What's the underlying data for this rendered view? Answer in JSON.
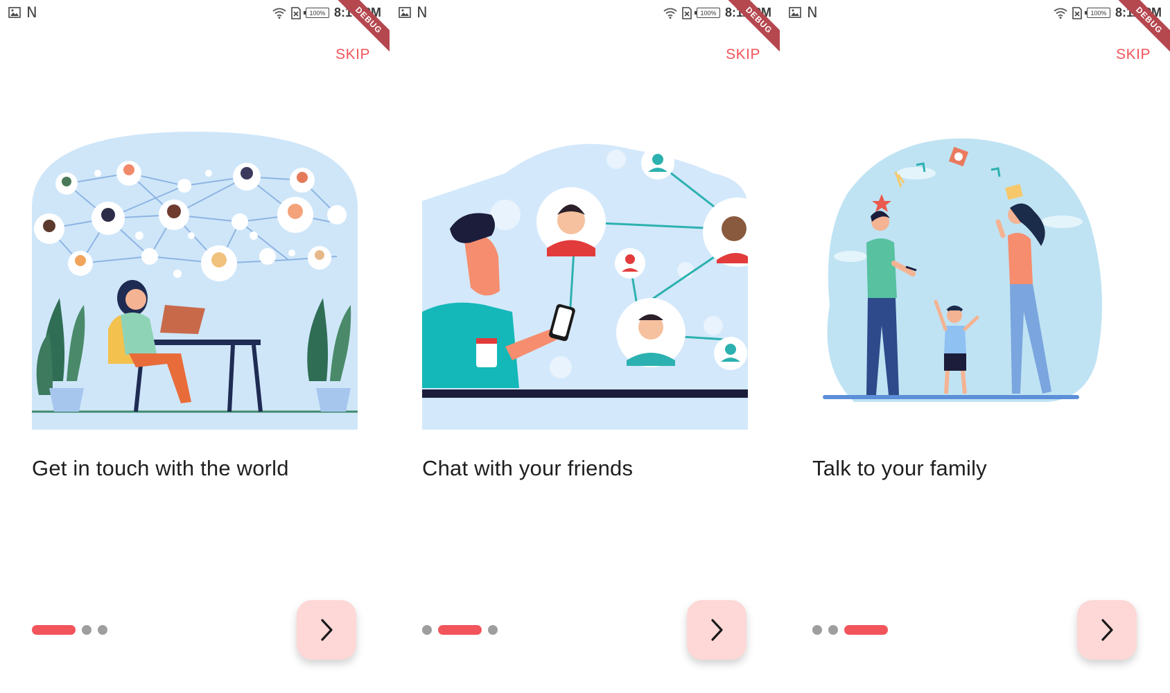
{
  "screens": [
    {
      "status": {
        "time": "8:10 PM",
        "left_letter": "N",
        "battery": "100%"
      },
      "debug_banner": "DEBUG",
      "skip_label": "SKIP",
      "title": "Get in touch with the world",
      "page_index": 0,
      "page_count": 3,
      "next_icon": "chevron-right-icon"
    },
    {
      "status": {
        "time": "8:11 PM",
        "left_letter": "N",
        "battery": "100%"
      },
      "debug_banner": "DEBUG",
      "skip_label": "SKIP",
      "title": "Chat with your friends",
      "page_index": 1,
      "page_count": 3,
      "next_icon": "chevron-right-icon"
    },
    {
      "status": {
        "time": "8:11 PM",
        "left_letter": "N",
        "battery": "100%"
      },
      "debug_banner": "DEBUG",
      "skip_label": "SKIP",
      "title": "Talk to your family",
      "page_index": 2,
      "page_count": 3,
      "next_icon": "chevron-right-icon"
    }
  ],
  "colors": {
    "accent": "#f2545b",
    "next_button_bg": "#fdd8d6",
    "inactive_dot": "#9e9e9e",
    "illustration_bg": "#cfe6f9"
  }
}
